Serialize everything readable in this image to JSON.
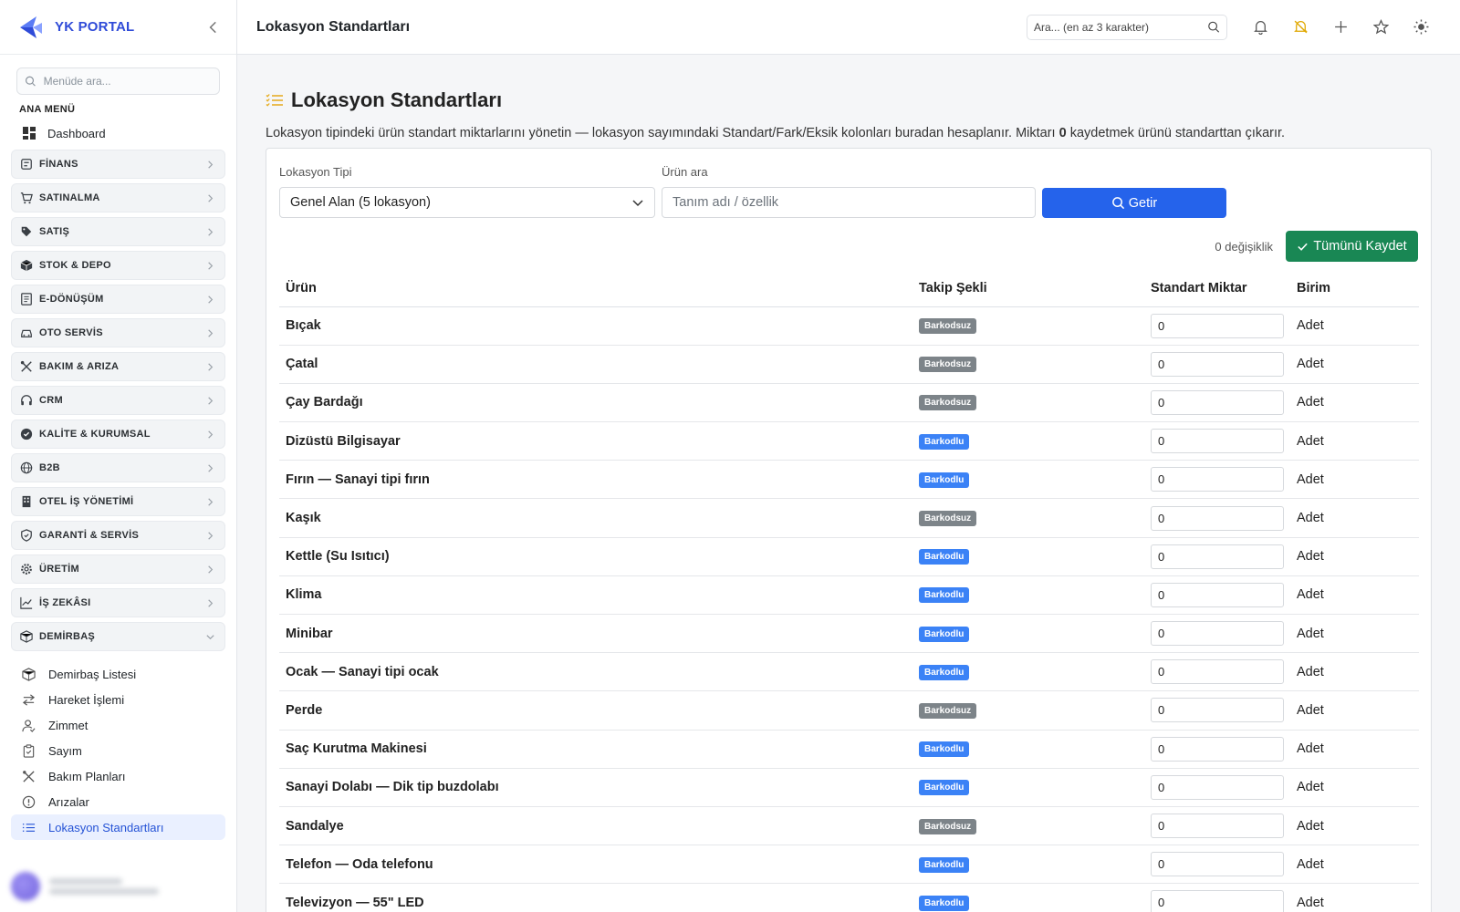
{
  "brand": {
    "name": "YK PORTAL"
  },
  "sidebar": {
    "search_placeholder": "Menüde ara...",
    "section_title": "ANA MENÜ",
    "dashboard": "Dashboard",
    "groups": [
      {
        "label": "FİNANS",
        "icon": "finance-icon"
      },
      {
        "label": "SATINALMA",
        "icon": "cart-icon"
      },
      {
        "label": "SATIŞ",
        "icon": "tag-icon"
      },
      {
        "label": "STOK & DEPO",
        "icon": "box-icon"
      },
      {
        "label": "E-DÖNÜŞÜM",
        "icon": "document-icon"
      },
      {
        "label": "OTO SERVİS",
        "icon": "car-icon"
      },
      {
        "label": "BAKIM & ARIZA",
        "icon": "tools-icon"
      },
      {
        "label": "CRM",
        "icon": "headset-icon"
      },
      {
        "label": "KALİTE & KURUMSAL",
        "icon": "badge-check-icon"
      },
      {
        "label": "B2B",
        "icon": "globe-icon"
      },
      {
        "label": "OTEL İŞ YÖNETİMİ",
        "icon": "building-icon"
      },
      {
        "label": "GARANTİ & SERVİS",
        "icon": "shield-icon"
      },
      {
        "label": "ÜRETİM",
        "icon": "gear-icon"
      },
      {
        "label": "İŞ ZEKÂSI",
        "icon": "chart-icon"
      },
      {
        "label": "DEMİRBAŞ",
        "icon": "box-icon"
      }
    ],
    "sub_items": [
      {
        "label": "Demirbaş Listesi",
        "icon": "box-icon"
      },
      {
        "label": "Hareket İşlemi",
        "icon": "arrows-icon"
      },
      {
        "label": "Zimmet",
        "icon": "person-icon"
      },
      {
        "label": "Sayım",
        "icon": "clipboard-check-icon"
      },
      {
        "label": "Bakım Planları",
        "icon": "tools-icon"
      },
      {
        "label": "Arızalar",
        "icon": "alert-circle-icon"
      },
      {
        "label": "Lokasyon Standartları",
        "icon": "list-icon"
      }
    ]
  },
  "topbar": {
    "title": "Lokasyon Standartları",
    "search_placeholder": "Ara... (en az 3 karakter)"
  },
  "page": {
    "heading": "Lokasyon Standartları",
    "desc_before": "Lokasyon tipindeki ürün standart miktarlarını yönetin — lokasyon sayımındaki Standart/Fark/Eksik kolonları buradan hesaplanır. Miktarı ",
    "desc_bold": "0",
    "desc_after": " kaydetmek ürünü standarttan çıkarır.",
    "filters": {
      "location_label": "Lokasyon Tipi",
      "location_value": "Genel Alan (5 lokasyon)",
      "product_label": "Ürün ara",
      "product_placeholder": "Tanım adı / özellik",
      "fetch_button": "Getir"
    },
    "change_count": "0 değişiklik",
    "save_all_button": "Tümünü Kaydet",
    "table": {
      "headers": [
        "Ürün",
        "Takip Şekli",
        "Standart Miktar",
        "Birim"
      ],
      "rows": [
        {
          "name": "Bıçak",
          "tracking": "Barkodsuz",
          "qty": "0",
          "unit": "Adet"
        },
        {
          "name": "Çatal",
          "tracking": "Barkodsuz",
          "qty": "0",
          "unit": "Adet"
        },
        {
          "name": "Çay Bardağı",
          "tracking": "Barkodsuz",
          "qty": "0",
          "unit": "Adet"
        },
        {
          "name": "Dizüstü Bilgisayar",
          "tracking": "Barkodlu",
          "qty": "0",
          "unit": "Adet"
        },
        {
          "name": "Fırın — Sanayi tipi fırın",
          "tracking": "Barkodlu",
          "qty": "0",
          "unit": "Adet"
        },
        {
          "name": "Kaşık",
          "tracking": "Barkodsuz",
          "qty": "0",
          "unit": "Adet"
        },
        {
          "name": "Kettle (Su Isıtıcı)",
          "tracking": "Barkodlu",
          "qty": "0",
          "unit": "Adet"
        },
        {
          "name": "Klima",
          "tracking": "Barkodlu",
          "qty": "0",
          "unit": "Adet"
        },
        {
          "name": "Minibar",
          "tracking": "Barkodlu",
          "qty": "0",
          "unit": "Adet"
        },
        {
          "name": "Ocak — Sanayi tipi ocak",
          "tracking": "Barkodlu",
          "qty": "0",
          "unit": "Adet"
        },
        {
          "name": "Perde",
          "tracking": "Barkodsuz",
          "qty": "0",
          "unit": "Adet"
        },
        {
          "name": "Saç Kurutma Makinesi",
          "tracking": "Barkodlu",
          "qty": "0",
          "unit": "Adet"
        },
        {
          "name": "Sanayi Dolabı — Dik tip buzdolabı",
          "tracking": "Barkodlu",
          "qty": "0",
          "unit": "Adet"
        },
        {
          "name": "Sandalye",
          "tracking": "Barkodsuz",
          "qty": "0",
          "unit": "Adet"
        },
        {
          "name": "Telefon — Oda telefonu",
          "tracking": "Barkodlu",
          "qty": "0",
          "unit": "Adet"
        },
        {
          "name": "Televizyon — 55\" LED",
          "tracking": "Barkodlu",
          "qty": "0",
          "unit": "Adet"
        }
      ]
    }
  },
  "colors": {
    "primary": "#2563eb",
    "success": "#198754",
    "badge_barkodlu": "#3b82f6",
    "badge_barkodsuz": "#7d8489",
    "brand": "#2f4bd8"
  }
}
